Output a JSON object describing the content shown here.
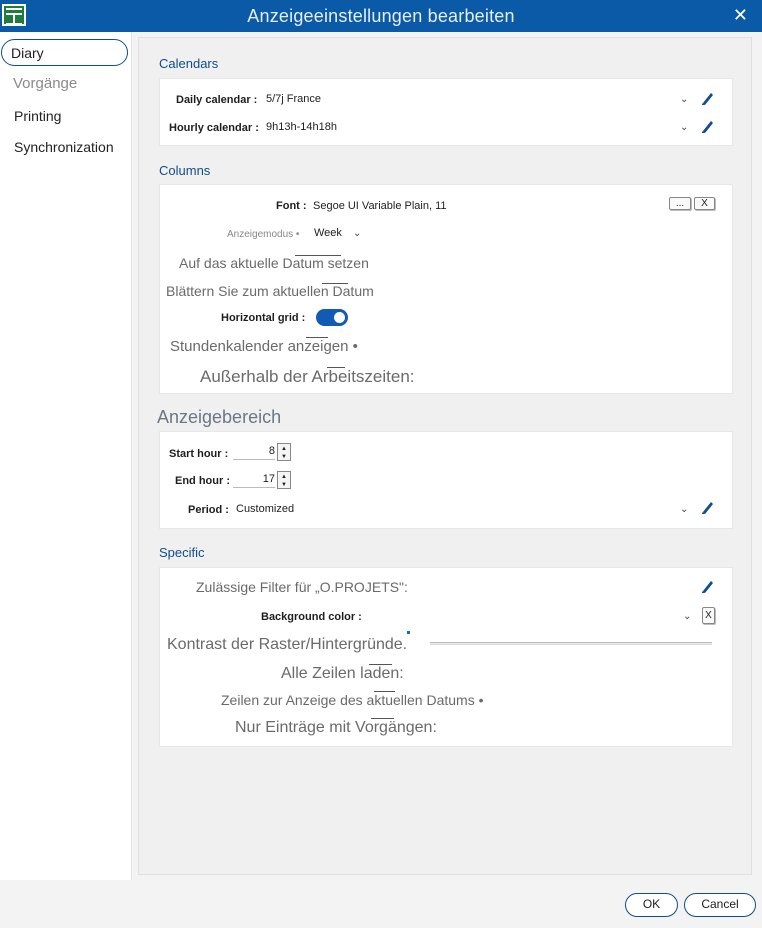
{
  "window": {
    "title": "Anzeigeeinstellungen bearbeiten"
  },
  "icons": {
    "app": "calendar-app-icon",
    "close": "close-icon",
    "edit": "pencil-icon",
    "dropdown": "chevron-down-icon"
  },
  "colors": {
    "accent": "#0f4e8c",
    "titlebar": "#0a5aa8",
    "toggle_on": "#0f5bb5"
  },
  "sidebar": {
    "items": [
      {
        "label": "Diary",
        "active": true
      },
      {
        "label": "Vorgänge"
      },
      {
        "label": "Printing"
      },
      {
        "label": "Synchronization"
      }
    ]
  },
  "calendars": {
    "title": "Calendars",
    "daily_label": "Daily calendar :",
    "daily_value": "5/7j France",
    "hourly_label": "Hourly calendar :",
    "hourly_value": "9h13h-14h18h"
  },
  "columns": {
    "title": "Columns",
    "font_label": "Font :",
    "font_value": "Segoe UI Variable Plain, 11",
    "font_browse": "...",
    "font_clear": "X",
    "mode_label": "Anzeigemodus •",
    "mode_value": "Week",
    "goto_today": "Auf das aktuelle Datum setzen",
    "scroll_today": "Blättern Sie zum aktuellen Datum",
    "hgrid_label": "Horizontal grid :",
    "hgrid_on": true,
    "show_hourly": "Stundenkalender anzeigen •",
    "outside_hours": "Außerhalb der Arbeitszeiten:"
  },
  "display_area": {
    "title": "Anzeigebereich",
    "start_label": "Start hour :",
    "start_value": "8",
    "end_label": "End hour :",
    "end_value": "17",
    "period_label": "Period :",
    "period_value": "Customized"
  },
  "specific": {
    "title": "Specific",
    "filters": "Zulässige Filter für „O.PROJETS\":",
    "bg_label": "Background color :",
    "bg_clear": "X",
    "contrast": "Kontrast der Raster/Hintergründe.",
    "load_rows": "Alle Zeilen laden:",
    "rows_today": "Zeilen zur Anzeige des aktuellen Datums •",
    "only_tasks": "Nur Einträge mit Vorgängen:"
  },
  "footer": {
    "ok": "OK",
    "cancel": "Cancel"
  }
}
